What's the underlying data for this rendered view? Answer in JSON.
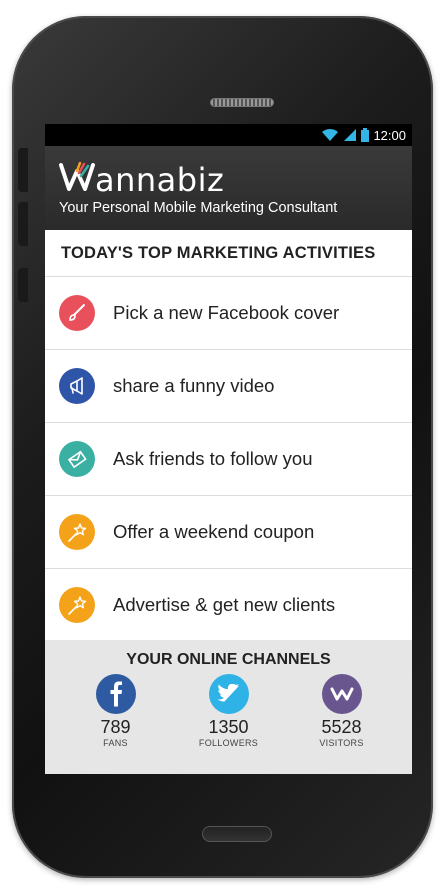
{
  "status_bar": {
    "time": "12:00",
    "icons": [
      "wifi-icon",
      "signal-icon",
      "battery-icon"
    ]
  },
  "header": {
    "app_name": "annabiz",
    "tagline": "Your Personal Mobile Marketing Consultant"
  },
  "activities": {
    "title": "TODAY'S TOP MARKETING ACTIVITIES",
    "items": [
      {
        "label": "Pick a new Facebook cover",
        "icon": "paintbrush-icon",
        "color": "#e8505b"
      },
      {
        "label": "share a funny video",
        "icon": "megaphone-icon",
        "color": "#2f55a8"
      },
      {
        "label": "Ask friends to follow you",
        "icon": "envelope-icon",
        "color": "#3ab0a3"
      },
      {
        "label": "Offer a weekend coupon",
        "icon": "star-wand-icon",
        "color": "#f5a21b"
      },
      {
        "label": "Advertise & get new clients",
        "icon": "star-wand-icon",
        "color": "#f5a21b"
      }
    ]
  },
  "channels": {
    "title": "YOUR ONLINE CHANNELS",
    "items": [
      {
        "count": "789",
        "label": "FANS",
        "icon": "facebook-icon",
        "color": "#2d5aa0"
      },
      {
        "count": "1350",
        "label": "FOLLOWERS",
        "icon": "twitter-icon",
        "color": "#2fb3e6"
      },
      {
        "count": "5528",
        "label": "VISITORS",
        "icon": "wannabiz-icon",
        "color": "#6a568f"
      }
    ]
  }
}
